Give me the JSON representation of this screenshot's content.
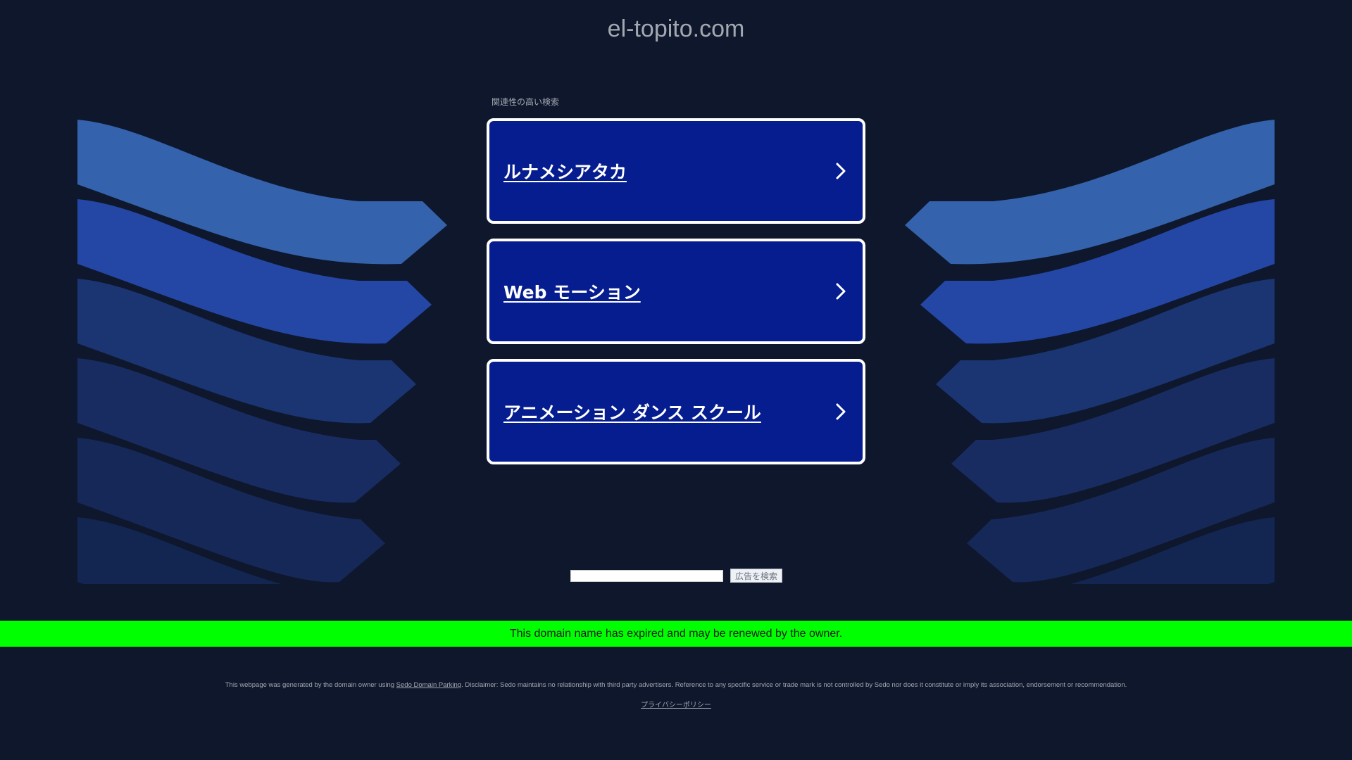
{
  "header": {
    "domain": "el-topito.com"
  },
  "related": {
    "label": "関連性の高い検索",
    "items": [
      {
        "label": "ルナメシアタカ"
      },
      {
        "label": "Web モーション"
      },
      {
        "label": "アニメーション ダンス スクール"
      }
    ]
  },
  "search": {
    "input_value": "",
    "button_label": "広告を検索"
  },
  "banner": {
    "text": "This domain name has expired and may be renewed by the owner."
  },
  "footer": {
    "disclaimer_prefix": "This webpage was generated by the domain owner using ",
    "disclaimer_link": "Sedo Domain Parking",
    "disclaimer_suffix": ". Disclaimer: Sedo maintains no relationship with third party advertisers. Reference to any specific service or trade mark is not controlled by Sedo nor does it constitute or imply its association, endorsement or recommendation.",
    "privacy_link": "プライバシーポリシー"
  },
  "colors": {
    "background": "#0e172c",
    "card_fill": "#051d8e",
    "card_border": "#ffffff",
    "banner": "#00ff00",
    "wing_bands": [
      "#3462ac",
      "#2447a6",
      "#1b3472",
      "#182c62",
      "#162857",
      "#132551"
    ]
  }
}
